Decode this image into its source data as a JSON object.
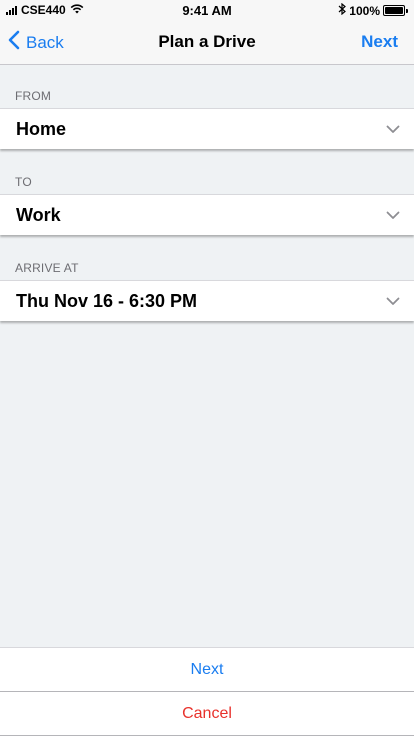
{
  "status_bar": {
    "carrier": "CSE440",
    "time": "9:41 AM",
    "battery": "100%",
    "icons": [
      "signal-icon",
      "wifi-icon",
      "bluetooth-icon",
      "battery-icon"
    ]
  },
  "nav": {
    "back_label": "Back",
    "title": "Plan a Drive",
    "next_label": "Next"
  },
  "form": {
    "from": {
      "label": "FROM",
      "value": "Home"
    },
    "to": {
      "label": "TO",
      "value": "Work"
    },
    "arrive_at": {
      "label": "ARRIVE AT",
      "value": "Thu Nov 16 - 6:30 PM"
    }
  },
  "actions": {
    "next_label": "Next",
    "cancel_label": "Cancel"
  },
  "colors": {
    "accent": "#1a7df0",
    "destructive": "#e8312b",
    "background": "#eff2f4"
  }
}
